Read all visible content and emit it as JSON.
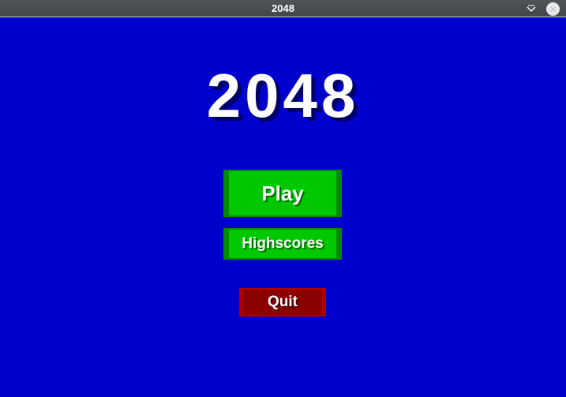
{
  "window": {
    "title": "2048",
    "controls": {
      "minimize_icon": "chevron-down-icon",
      "close_icon": "close-icon"
    }
  },
  "menu": {
    "game_title": "2048",
    "play_label": "Play",
    "highscores_label": "Highscores",
    "quit_label": "Quit"
  },
  "colors": {
    "background": "#0000cc",
    "primary_button": "#00c800",
    "quit_button": "#8b0000",
    "titlebar": "#4a4e52"
  }
}
